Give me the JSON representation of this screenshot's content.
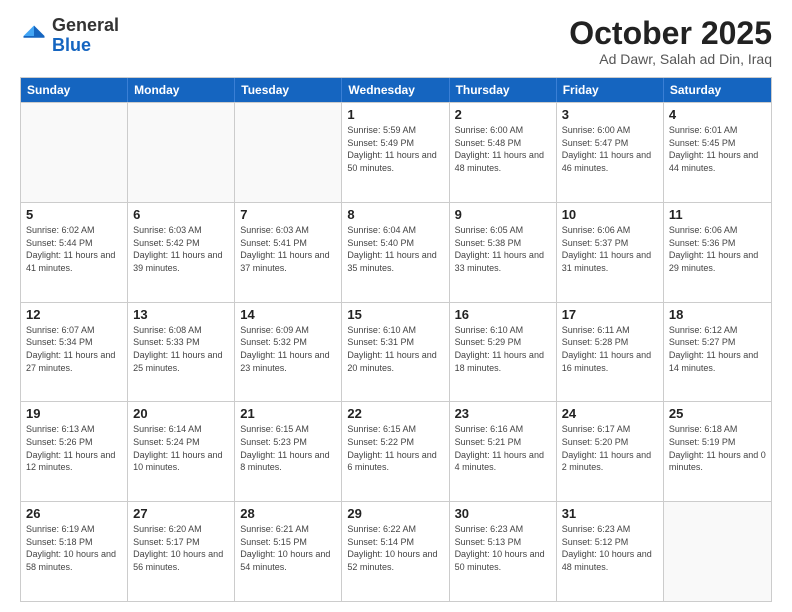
{
  "logo": {
    "general": "General",
    "blue": "Blue"
  },
  "header": {
    "month": "October 2025",
    "location": "Ad Dawr, Salah ad Din, Iraq"
  },
  "weekdays": [
    "Sunday",
    "Monday",
    "Tuesday",
    "Wednesday",
    "Thursday",
    "Friday",
    "Saturday"
  ],
  "weeks": [
    [
      {
        "day": "",
        "empty": true
      },
      {
        "day": "",
        "empty": true
      },
      {
        "day": "",
        "empty": true
      },
      {
        "day": "1",
        "sunrise": "Sunrise: 5:59 AM",
        "sunset": "Sunset: 5:49 PM",
        "daylight": "Daylight: 11 hours and 50 minutes."
      },
      {
        "day": "2",
        "sunrise": "Sunrise: 6:00 AM",
        "sunset": "Sunset: 5:48 PM",
        "daylight": "Daylight: 11 hours and 48 minutes."
      },
      {
        "day": "3",
        "sunrise": "Sunrise: 6:00 AM",
        "sunset": "Sunset: 5:47 PM",
        "daylight": "Daylight: 11 hours and 46 minutes."
      },
      {
        "day": "4",
        "sunrise": "Sunrise: 6:01 AM",
        "sunset": "Sunset: 5:45 PM",
        "daylight": "Daylight: 11 hours and 44 minutes."
      }
    ],
    [
      {
        "day": "5",
        "sunrise": "Sunrise: 6:02 AM",
        "sunset": "Sunset: 5:44 PM",
        "daylight": "Daylight: 11 hours and 41 minutes."
      },
      {
        "day": "6",
        "sunrise": "Sunrise: 6:03 AM",
        "sunset": "Sunset: 5:42 PM",
        "daylight": "Daylight: 11 hours and 39 minutes."
      },
      {
        "day": "7",
        "sunrise": "Sunrise: 6:03 AM",
        "sunset": "Sunset: 5:41 PM",
        "daylight": "Daylight: 11 hours and 37 minutes."
      },
      {
        "day": "8",
        "sunrise": "Sunrise: 6:04 AM",
        "sunset": "Sunset: 5:40 PM",
        "daylight": "Daylight: 11 hours and 35 minutes."
      },
      {
        "day": "9",
        "sunrise": "Sunrise: 6:05 AM",
        "sunset": "Sunset: 5:38 PM",
        "daylight": "Daylight: 11 hours and 33 minutes."
      },
      {
        "day": "10",
        "sunrise": "Sunrise: 6:06 AM",
        "sunset": "Sunset: 5:37 PM",
        "daylight": "Daylight: 11 hours and 31 minutes."
      },
      {
        "day": "11",
        "sunrise": "Sunrise: 6:06 AM",
        "sunset": "Sunset: 5:36 PM",
        "daylight": "Daylight: 11 hours and 29 minutes."
      }
    ],
    [
      {
        "day": "12",
        "sunrise": "Sunrise: 6:07 AM",
        "sunset": "Sunset: 5:34 PM",
        "daylight": "Daylight: 11 hours and 27 minutes."
      },
      {
        "day": "13",
        "sunrise": "Sunrise: 6:08 AM",
        "sunset": "Sunset: 5:33 PM",
        "daylight": "Daylight: 11 hours and 25 minutes."
      },
      {
        "day": "14",
        "sunrise": "Sunrise: 6:09 AM",
        "sunset": "Sunset: 5:32 PM",
        "daylight": "Daylight: 11 hours and 23 minutes."
      },
      {
        "day": "15",
        "sunrise": "Sunrise: 6:10 AM",
        "sunset": "Sunset: 5:31 PM",
        "daylight": "Daylight: 11 hours and 20 minutes."
      },
      {
        "day": "16",
        "sunrise": "Sunrise: 6:10 AM",
        "sunset": "Sunset: 5:29 PM",
        "daylight": "Daylight: 11 hours and 18 minutes."
      },
      {
        "day": "17",
        "sunrise": "Sunrise: 6:11 AM",
        "sunset": "Sunset: 5:28 PM",
        "daylight": "Daylight: 11 hours and 16 minutes."
      },
      {
        "day": "18",
        "sunrise": "Sunrise: 6:12 AM",
        "sunset": "Sunset: 5:27 PM",
        "daylight": "Daylight: 11 hours and 14 minutes."
      }
    ],
    [
      {
        "day": "19",
        "sunrise": "Sunrise: 6:13 AM",
        "sunset": "Sunset: 5:26 PM",
        "daylight": "Daylight: 11 hours and 12 minutes."
      },
      {
        "day": "20",
        "sunrise": "Sunrise: 6:14 AM",
        "sunset": "Sunset: 5:24 PM",
        "daylight": "Daylight: 11 hours and 10 minutes."
      },
      {
        "day": "21",
        "sunrise": "Sunrise: 6:15 AM",
        "sunset": "Sunset: 5:23 PM",
        "daylight": "Daylight: 11 hours and 8 minutes."
      },
      {
        "day": "22",
        "sunrise": "Sunrise: 6:15 AM",
        "sunset": "Sunset: 5:22 PM",
        "daylight": "Daylight: 11 hours and 6 minutes."
      },
      {
        "day": "23",
        "sunrise": "Sunrise: 6:16 AM",
        "sunset": "Sunset: 5:21 PM",
        "daylight": "Daylight: 11 hours and 4 minutes."
      },
      {
        "day": "24",
        "sunrise": "Sunrise: 6:17 AM",
        "sunset": "Sunset: 5:20 PM",
        "daylight": "Daylight: 11 hours and 2 minutes."
      },
      {
        "day": "25",
        "sunrise": "Sunrise: 6:18 AM",
        "sunset": "Sunset: 5:19 PM",
        "daylight": "Daylight: 11 hours and 0 minutes."
      }
    ],
    [
      {
        "day": "26",
        "sunrise": "Sunrise: 6:19 AM",
        "sunset": "Sunset: 5:18 PM",
        "daylight": "Daylight: 10 hours and 58 minutes."
      },
      {
        "day": "27",
        "sunrise": "Sunrise: 6:20 AM",
        "sunset": "Sunset: 5:17 PM",
        "daylight": "Daylight: 10 hours and 56 minutes."
      },
      {
        "day": "28",
        "sunrise": "Sunrise: 6:21 AM",
        "sunset": "Sunset: 5:15 PM",
        "daylight": "Daylight: 10 hours and 54 minutes."
      },
      {
        "day": "29",
        "sunrise": "Sunrise: 6:22 AM",
        "sunset": "Sunset: 5:14 PM",
        "daylight": "Daylight: 10 hours and 52 minutes."
      },
      {
        "day": "30",
        "sunrise": "Sunrise: 6:23 AM",
        "sunset": "Sunset: 5:13 PM",
        "daylight": "Daylight: 10 hours and 50 minutes."
      },
      {
        "day": "31",
        "sunrise": "Sunrise: 6:23 AM",
        "sunset": "Sunset: 5:12 PM",
        "daylight": "Daylight: 10 hours and 48 minutes."
      },
      {
        "day": "",
        "empty": true
      }
    ]
  ]
}
